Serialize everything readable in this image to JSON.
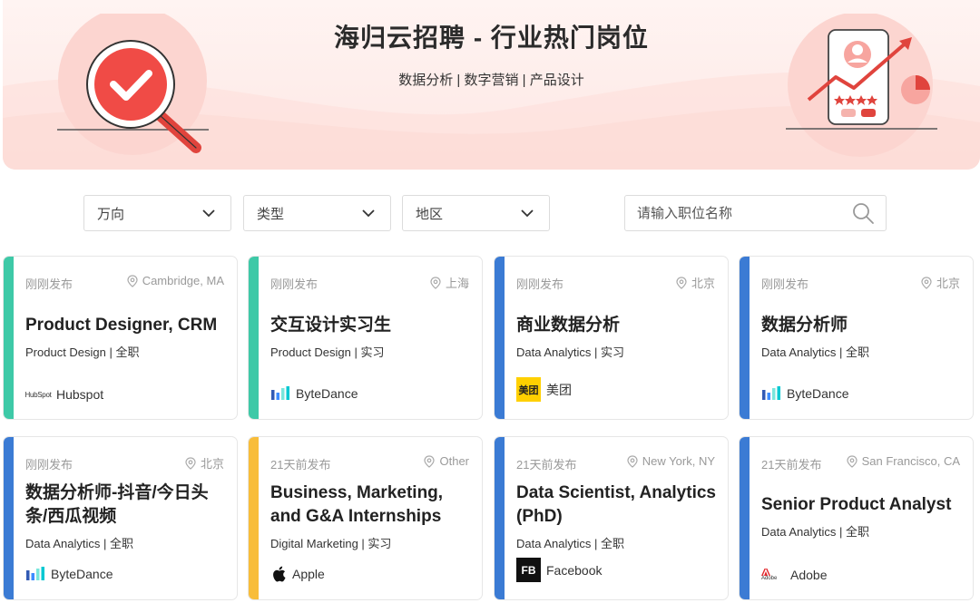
{
  "banner": {
    "title": "海归云招聘 - 行业热门岗位",
    "subtitle": "数据分析 | 数字营销 | 产品设计"
  },
  "filters": {
    "direction": "万向",
    "type": "类型",
    "region": "地区",
    "search_placeholder": "请输入职位名称"
  },
  "colors": {
    "teal": "#3ec9a7",
    "blue": "#3b7bd4",
    "yellow": "#f8bd3a",
    "brand_red": "#f15a5a"
  },
  "jobs": [
    {
      "posted": "刚刚发布",
      "location": "Cambridge, MA",
      "title": "Product Designer, CRM",
      "category": "Product Design",
      "kind": "全职",
      "company": "Hubspot",
      "logo_icon": "hubspot-logo",
      "logo_text": "HubSpot",
      "accent": "teal"
    },
    {
      "posted": "刚刚发布",
      "location": "上海",
      "title": "交互设计实习生",
      "category": "Product Design",
      "kind": "实习",
      "company": "ByteDance",
      "logo_icon": "bytedance-logo",
      "accent": "teal"
    },
    {
      "posted": "刚刚发布",
      "location": "北京",
      "title": "商业数据分析",
      "category": "Data Analytics",
      "kind": "实习",
      "company": "美团",
      "logo_icon": "meituan-logo",
      "logo_text": "美团",
      "accent": "blue"
    },
    {
      "posted": "刚刚发布",
      "location": "北京",
      "title": "数据分析师",
      "category": "Data Analytics",
      "kind": "全职",
      "company": "ByteDance",
      "logo_icon": "bytedance-logo",
      "accent": "blue"
    },
    {
      "posted": "刚刚发布",
      "location": "北京",
      "title": "数据分析师-抖音/今日头条/西瓜视频",
      "category": "Data Analytics",
      "kind": "全职",
      "company": "ByteDance",
      "logo_icon": "bytedance-logo",
      "accent": "blue"
    },
    {
      "posted": "21天前发布",
      "location": "Other",
      "title": "Business, Marketing, and G&A Internships",
      "category": "Digital Marketing",
      "kind": "实习",
      "company": "Apple",
      "logo_icon": "apple-logo",
      "accent": "yellow"
    },
    {
      "posted": "21天前发布",
      "location": "New York, NY",
      "title": "Data Scientist, Analytics (PhD)",
      "category": "Data Analytics",
      "kind": "全职",
      "company": "Facebook",
      "logo_icon": "facebook-logo",
      "logo_text": "FB",
      "accent": "blue"
    },
    {
      "posted": "21天前发布",
      "location": "San Francisco, CA",
      "title": "Senior Product Analyst",
      "category": "Data Analytics",
      "kind": "全职",
      "company": "Adobe",
      "logo_icon": "adobe-logo",
      "logo_text": "Adobe",
      "accent": "blue"
    }
  ]
}
